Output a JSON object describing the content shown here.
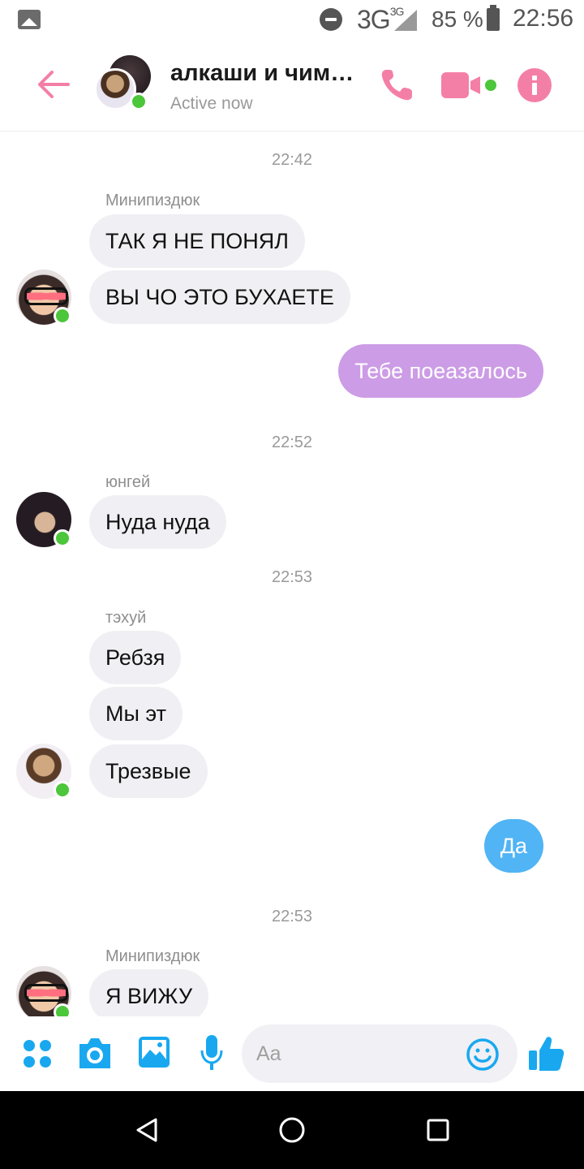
{
  "status_bar": {
    "network": "3G",
    "network_sup": "3G",
    "battery": "85 %",
    "time": "22:56"
  },
  "header": {
    "title": "алкаши и чим…",
    "status": "Active now"
  },
  "messages": {
    "ts1": "22:42",
    "sender1": "Минипиздюк",
    "m1": "ТАК Я НЕ ПОНЯЛ",
    "m2": "ВЫ ЧО ЭТО БУХАЕТЕ",
    "m3": "Тебе поеазалось",
    "ts2": "22:52",
    "sender2": "юнгей",
    "m4": "Нуда нуда",
    "ts3": "22:53",
    "sender3": "тэхуй",
    "m5": "Ребзя",
    "m6": "Мы эт",
    "m7": "Трезвые",
    "m8": "Да",
    "ts4": "22:53",
    "sender4": "Минипиздюк",
    "m9": "Я ВИЖУ"
  },
  "composer": {
    "placeholder": "Aa"
  },
  "colors": {
    "accent_pink": "#f47fa6",
    "outgoing_purple": "#cc9ce6",
    "outgoing_blue": "#50b4f5",
    "incoming_gray": "#f0eff3",
    "composer_blue": "#19a8f0",
    "online_green": "#4cc63b"
  },
  "icons": {
    "header": [
      "back-arrow-icon",
      "phone-icon",
      "video-camera-icon",
      "info-icon"
    ],
    "composer": [
      "apps-grid-icon",
      "camera-icon",
      "gallery-icon",
      "microphone-icon",
      "emoji-icon",
      "thumbs-up-icon"
    ],
    "nav": [
      "back-triangle-icon",
      "home-circle-icon",
      "recents-square-icon"
    ]
  }
}
